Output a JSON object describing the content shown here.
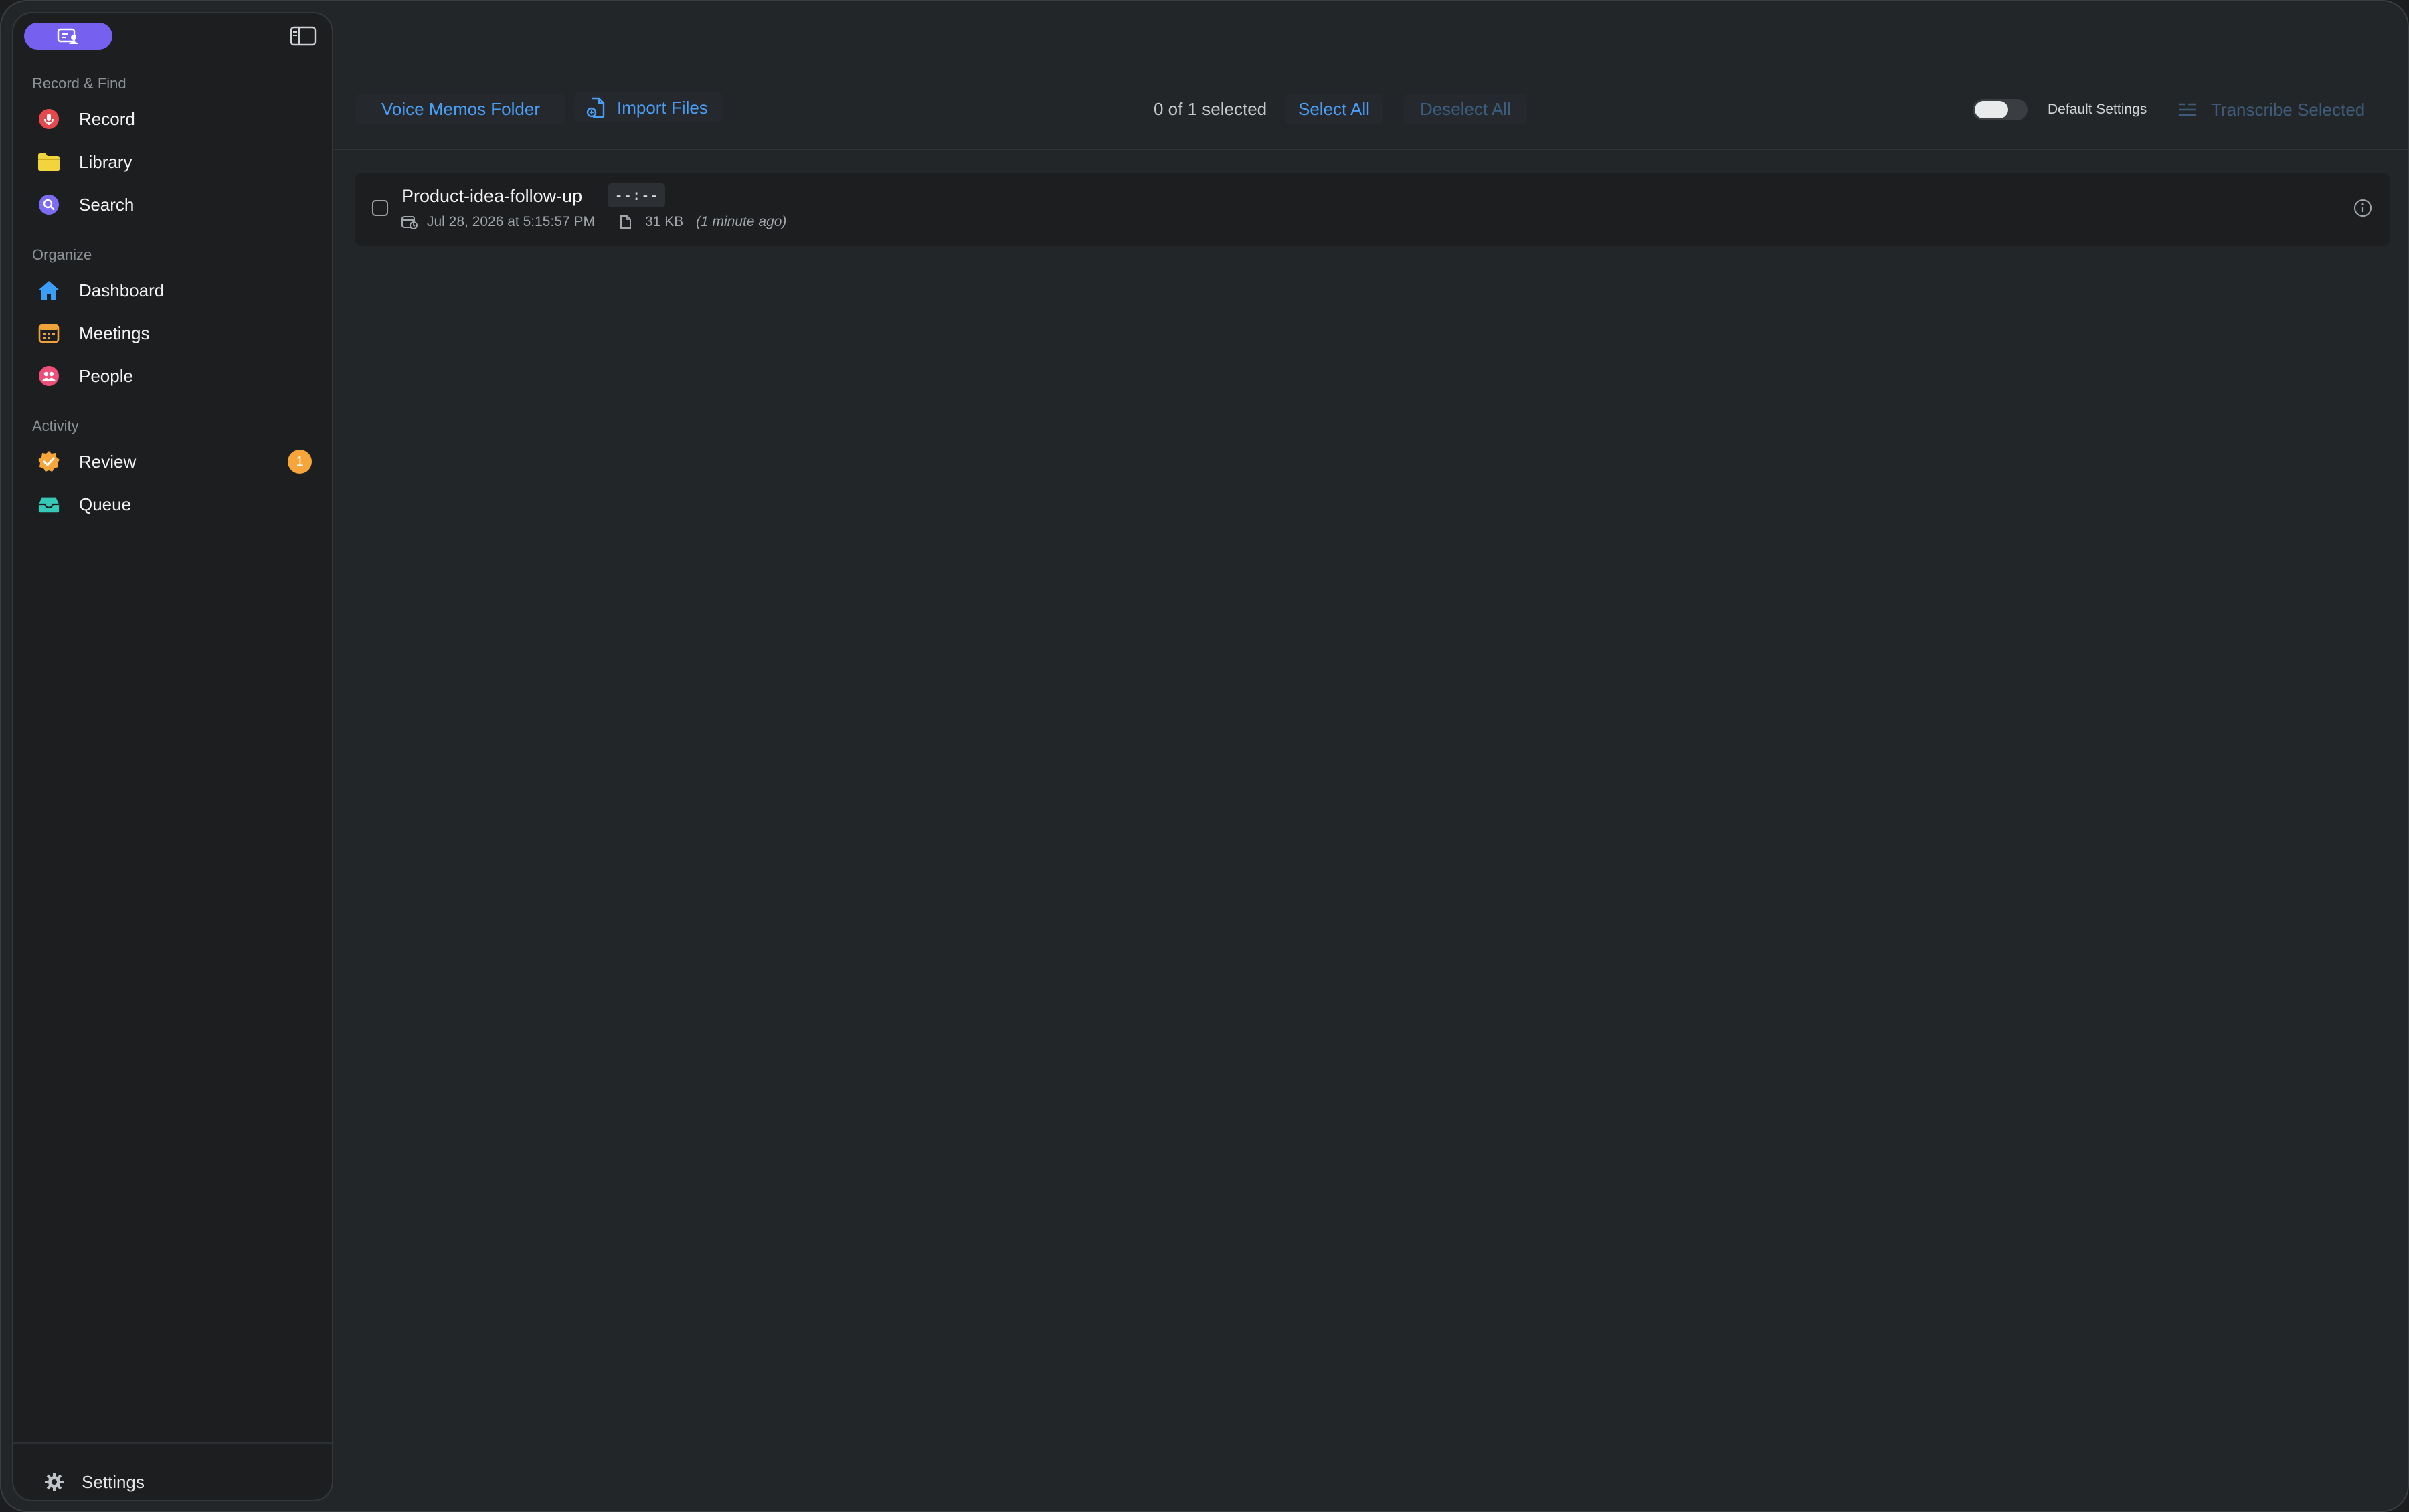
{
  "sidebar": {
    "sections": [
      {
        "label": "Record & Find"
      },
      {
        "label": "Organize"
      },
      {
        "label": "Activity"
      }
    ],
    "items": [
      {
        "label": "Record",
        "icon": "record-icon",
        "color": "#e5484d"
      },
      {
        "label": "Library",
        "icon": "folder-icon",
        "color": "#f2d53c"
      },
      {
        "label": "Search",
        "icon": "search-icon",
        "color": "#7c6cf2"
      },
      {
        "label": "Dashboard",
        "icon": "home-icon",
        "color": "#3b9df6"
      },
      {
        "label": "Meetings",
        "icon": "calendar-icon",
        "color": "#f0a23a"
      },
      {
        "label": "People",
        "icon": "people-icon",
        "color": "#ec4f7a"
      },
      {
        "label": "Review",
        "icon": "review-badge-icon",
        "color": "#f5a53a",
        "badge": "1"
      },
      {
        "label": "Queue",
        "icon": "inbox-tray-icon",
        "color": "#36c9b6"
      }
    ],
    "settings_label": "Settings"
  },
  "toolbar": {
    "voice_memos_label": "Voice Memos Folder",
    "import_label": "Import Files",
    "selected_count": "0 of 1 selected",
    "select_all_label": "Select All",
    "deselect_all_label": "Deselect All",
    "default_settings_label": "Default Settings",
    "default_settings_on": false,
    "transcribe_label": "Transcribe Selected"
  },
  "files": [
    {
      "name": "Product-idea-follow-up",
      "duration": "--:--",
      "date": "Jul 28, 2026 at 5:15:57 PM",
      "size": "31 KB",
      "relative": "(1 minute ago)",
      "selected": false
    }
  ],
  "colors": {
    "accent": "#4a9ef5",
    "app_pill": "#7660f0",
    "badge": "#f5a53a"
  }
}
